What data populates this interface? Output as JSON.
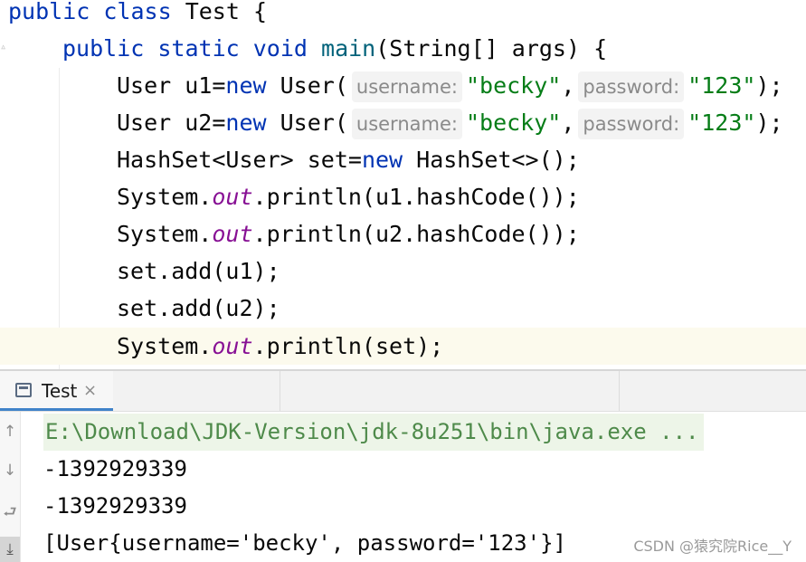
{
  "editor": {
    "line1": {
      "kw1": "public",
      "kw2": "class",
      "name": "Test {"
    },
    "line2": {
      "kw1": "public",
      "kw2": "static",
      "kw3": "void",
      "fn": "main",
      "rest": "(String[] args) {"
    },
    "line3": {
      "pre": "User u1=",
      "kw": "new",
      "ctor": " User(",
      "hint1": "username:",
      "str1": "\"becky\"",
      "comma": ",",
      "hint2": "password:",
      "str2": "\"123\"",
      "end": ");"
    },
    "line4": {
      "pre": "User u2=",
      "kw": "new",
      "ctor": " User(",
      "hint1": "username:",
      "str1": "\"becky\"",
      "comma": ",",
      "hint2": "password:",
      "str2": "\"123\"",
      "end": ");"
    },
    "line5": {
      "pre": "HashSet<User> set=",
      "kw": "new",
      "post": " HashSet<>();"
    },
    "line6": {
      "pre": "System.",
      "fld": "out",
      "post": ".println(u1.hashCode());"
    },
    "line7": {
      "pre": "System.",
      "fld": "out",
      "post": ".println(u2.hashCode());"
    },
    "line8": {
      "text": "set.add(u1);"
    },
    "line9": {
      "text": "set.add(u2);"
    },
    "line10": {
      "pre": "System.",
      "fld": "out",
      "post": ".println(set);"
    }
  },
  "run_panel": {
    "tab_label": "Test",
    "tab_close": "×",
    "gutter_icons": [
      "↑",
      "↓",
      "⮐",
      "⤓"
    ]
  },
  "console": {
    "lines": [
      "E:\\Download\\JDK-Version\\jdk-8u251\\bin\\java.exe ...",
      "-1392929339",
      "-1392929339",
      "[User{username='becky', password='123'}]"
    ]
  },
  "watermark": "CSDN @猿究院Rice__Y",
  "colors": {
    "keyword": "#0033b3",
    "string": "#067d17",
    "method": "#00627a",
    "field": "#871094",
    "accent": "#4083c9"
  }
}
